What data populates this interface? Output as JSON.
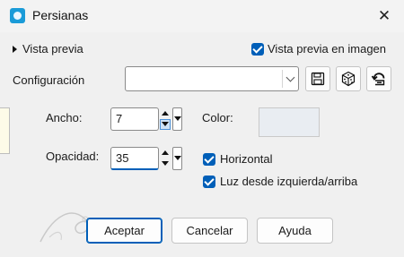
{
  "window": {
    "title": "Persianas",
    "close_glyph": "✕",
    "app_icon": "image-app-icon"
  },
  "preview": {
    "toggle_label": "Vista previa",
    "image_preview_label": "Vista previa en imagen",
    "image_preview_checked": true
  },
  "config": {
    "label": "Configuración",
    "combo_value": "",
    "tools": [
      {
        "name": "save-preset-button",
        "icon": "floppy-disk-icon"
      },
      {
        "name": "random-button",
        "icon": "dice-icon"
      },
      {
        "name": "reset-button",
        "icon": "reset-arrow-icon"
      }
    ]
  },
  "params": {
    "width_label": "Ancho:",
    "width_value": "7",
    "opacity_label": "Opacidad:",
    "opacity_value": "35",
    "color_label": "Color:",
    "color_hex": "#e9edf2",
    "horizontal_label": "Horizontal",
    "horizontal_checked": true,
    "light_label": "Luz desde izquierda/arriba",
    "light_checked": true
  },
  "buttons": {
    "ok": "Aceptar",
    "cancel": "Cancelar",
    "help": "Ayuda"
  }
}
